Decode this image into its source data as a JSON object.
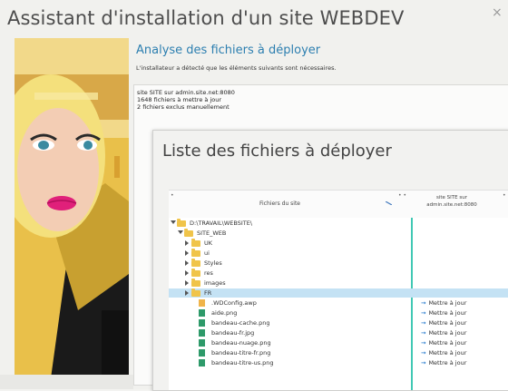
{
  "window": {
    "title": "Assistant d'installation d'un site WEBDEV",
    "close_glyph": "×"
  },
  "wizard": {
    "subtitle": "Analyse des fichiers à déployer",
    "description": "L'installateur a détecté que les éléments suivants sont nécessaires.",
    "info_lines": [
      "site SITE sur admin.site.net:8080",
      "1648 fichiers à mettre à jour",
      "2 fichiers exclus manuellement"
    ]
  },
  "file_list": {
    "title": "Liste des fichiers à déployer",
    "col_site": "Fichiers du site",
    "col_server_line1": "site SITE sur",
    "col_server_line2": "admin.site.net:8080",
    "tree": [
      {
        "label": "D:\\TRAVAIL\\WEBSITE\\",
        "kind": "folder",
        "level": 0,
        "expander": "open"
      },
      {
        "label": "SITE_WEB",
        "kind": "folder",
        "level": 1,
        "expander": "open"
      },
      {
        "label": "UK",
        "kind": "folder",
        "level": 2,
        "expander": "closed"
      },
      {
        "label": "ui",
        "kind": "folder",
        "level": 2,
        "expander": "closed"
      },
      {
        "label": "Styles",
        "kind": "folder",
        "level": 2,
        "expander": "closed"
      },
      {
        "label": "res",
        "kind": "folder",
        "level": 2,
        "expander": "closed"
      },
      {
        "label": "images",
        "kind": "folder",
        "level": 2,
        "expander": "closed"
      },
      {
        "label": "FR",
        "kind": "folder",
        "level": 2,
        "expander": "closed",
        "selected": true
      },
      {
        "label": ".WDConfig.awp",
        "kind": "awp",
        "level": 3,
        "action": "Mettre à jour"
      },
      {
        "label": "aide.png",
        "kind": "file",
        "level": 3,
        "action": "Mettre à jour"
      },
      {
        "label": "bandeau-cache.png",
        "kind": "file",
        "level": 3,
        "action": "Mettre à jour"
      },
      {
        "label": "bandeau-fr.jpg",
        "kind": "file",
        "level": 3,
        "action": "Mettre à jour"
      },
      {
        "label": "bandeau-nuage.png",
        "kind": "file",
        "level": 3,
        "action": "Mettre à jour"
      },
      {
        "label": "bandeau-titre-fr.png",
        "kind": "file",
        "level": 3,
        "action": "Mettre à jour"
      },
      {
        "label": "bandeau-titre-us.png",
        "kind": "file",
        "level": 3,
        "action": "Mettre à jour"
      }
    ]
  },
  "colors": {
    "accent": "#2d7fb0",
    "selection": "#c4e2f4",
    "column_line": "#40c8b4",
    "folder": "#f0c44a"
  }
}
